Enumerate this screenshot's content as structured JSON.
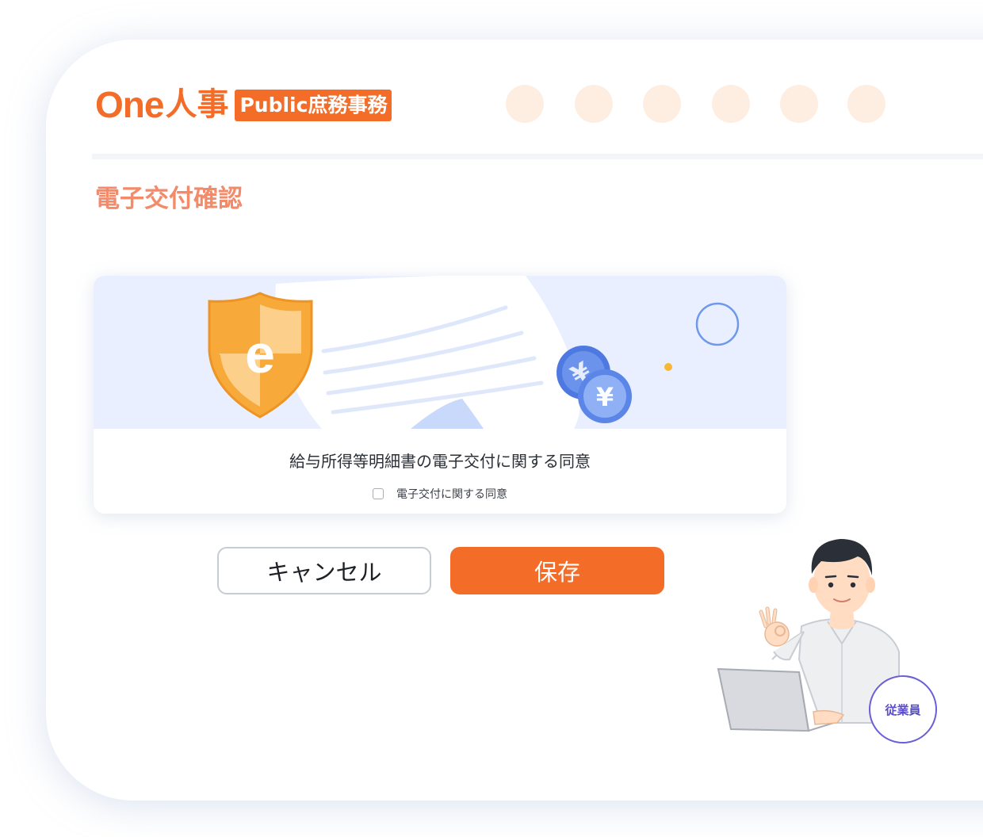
{
  "brand": {
    "logo_one": "One",
    "logo_jinji": "人事",
    "logo_badge": "Public庶務事務"
  },
  "page_title": "電子交付確認",
  "consent": {
    "title": "給与所得等明細書の電子交付に関する同意",
    "checkbox_label": "電子交付に関する同意",
    "checked": false
  },
  "actions": {
    "cancel_label": "キャンセル",
    "save_label": "保存"
  },
  "illustration": {
    "role_label": "従業員"
  },
  "icons": {
    "shield": "e-shield-icon",
    "coins": "yen-coin-icon",
    "document": "document-icon"
  },
  "colors": {
    "brand_orange": "#f36d28",
    "title_salmon": "#f38a6a",
    "banner_bg": "#e9efff",
    "role_purple": "#6a5fd6"
  }
}
